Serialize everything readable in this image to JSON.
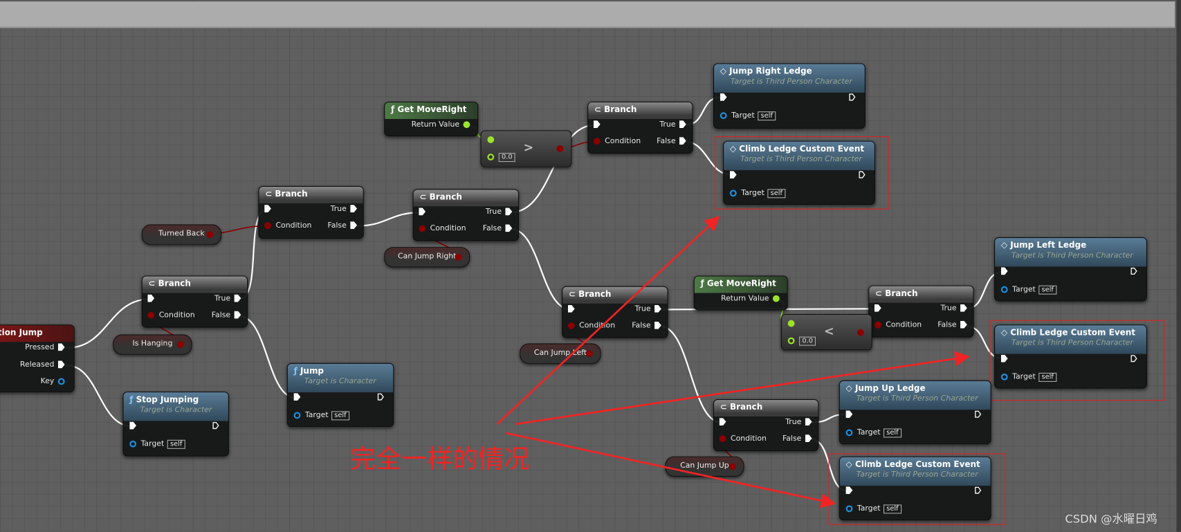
{
  "colors": {
    "exec_wire": "#ffffff",
    "bool_pin": "#8b0000",
    "float_pin": "#9be32b",
    "object_pin": "#1d8fe0",
    "annotation": "#f02424",
    "event_header": "#8a1616",
    "function_header": "#5a7c96",
    "pure_header": "#4d7a45"
  },
  "nodes": [
    {
      "id": "evt",
      "type": "event",
      "title": "InputAction Jump",
      "title_visible": "utAction Jump",
      "pins": [
        "Pressed",
        "Released",
        "Key"
      ]
    },
    {
      "id": "br1",
      "type": "branch",
      "title": "Branch",
      "icon": "branch-icon",
      "pins": [
        "Condition",
        "True",
        "False"
      ]
    },
    {
      "id": "br2",
      "type": "branch",
      "title": "Branch",
      "icon": "branch-icon",
      "pins": [
        "Condition",
        "True",
        "False"
      ]
    },
    {
      "id": "br3",
      "type": "branch",
      "title": "Branch",
      "icon": "branch-icon",
      "pins": [
        "Condition",
        "True",
        "False"
      ]
    },
    {
      "id": "br4",
      "type": "branch",
      "title": "Branch",
      "icon": "branch-icon",
      "pins": [
        "Condition",
        "True",
        "False"
      ]
    },
    {
      "id": "br5",
      "type": "branch",
      "title": "Branch",
      "icon": "branch-icon",
      "pins": [
        "Condition",
        "True",
        "False"
      ]
    },
    {
      "id": "br6",
      "type": "branch",
      "title": "Branch",
      "icon": "branch-icon",
      "pins": [
        "Condition",
        "True",
        "False"
      ]
    },
    {
      "id": "br7",
      "type": "branch",
      "title": "Branch",
      "icon": "branch-icon",
      "pins": [
        "Condition",
        "True",
        "False"
      ]
    },
    {
      "id": "getmr1",
      "type": "pure",
      "title": "Get MoveRight",
      "icon": "function-icon",
      "pins": [
        "Return Value"
      ]
    },
    {
      "id": "getmr2",
      "type": "pure",
      "title": "Get MoveRight",
      "icon": "function-icon",
      "pins": [
        "Return Value"
      ]
    },
    {
      "id": "cmp1",
      "type": "compare",
      "operator": ">",
      "value": "0.0"
    },
    {
      "id": "cmp2",
      "type": "compare",
      "operator": "<",
      "value": "0.0"
    },
    {
      "id": "jrl",
      "type": "event_call",
      "title": "Jump Right Ledge",
      "subtitle": "Target is Third Person Character",
      "target": "Target",
      "target_value": "self"
    },
    {
      "id": "cl1",
      "type": "event_call",
      "title": "Climb Ledge Custom Event",
      "subtitle": "Target is Third Person Character",
      "target": "Target",
      "target_value": "self"
    },
    {
      "id": "jll",
      "type": "event_call",
      "title": "Jump Left Ledge",
      "subtitle": "Target is Third Person Character",
      "target": "Target",
      "target_value": "self"
    },
    {
      "id": "cl2",
      "type": "event_call",
      "title": "Climb Ledge Custom Event",
      "subtitle": "Target is Third Person Character",
      "target": "Target",
      "target_value": "self"
    },
    {
      "id": "jul",
      "type": "event_call",
      "title": "Jump Up Ledge",
      "subtitle": "Target is Third Person Character",
      "target": "Target",
      "target_value": "self"
    },
    {
      "id": "cl3",
      "type": "event_call",
      "title": "Climb Ledge Custom Event",
      "subtitle": "Target is Third Person Character",
      "target": "Target",
      "target_value": "self"
    },
    {
      "id": "jump",
      "type": "function",
      "title": "Jump",
      "subtitle": "Target is Character",
      "target": "Target",
      "target_value": "self"
    },
    {
      "id": "stop",
      "type": "function",
      "title": "Stop Jumping",
      "subtitle": "Target is Character",
      "target": "Target",
      "target_value": "self"
    }
  ],
  "variables": [
    {
      "id": "v_hang",
      "label": "Is Hanging"
    },
    {
      "id": "v_turn",
      "label": "Turned Back"
    },
    {
      "id": "v_right",
      "label": "Can Jump Right"
    },
    {
      "id": "v_left",
      "label": "Can Jump Left"
    },
    {
      "id": "v_up",
      "label": "Can Jump Up"
    }
  ],
  "annotation": {
    "text": "完全一样的情况",
    "highlighted": [
      "cl1",
      "cl2",
      "cl3"
    ]
  },
  "watermark": "CSDN @水曜日鸡"
}
